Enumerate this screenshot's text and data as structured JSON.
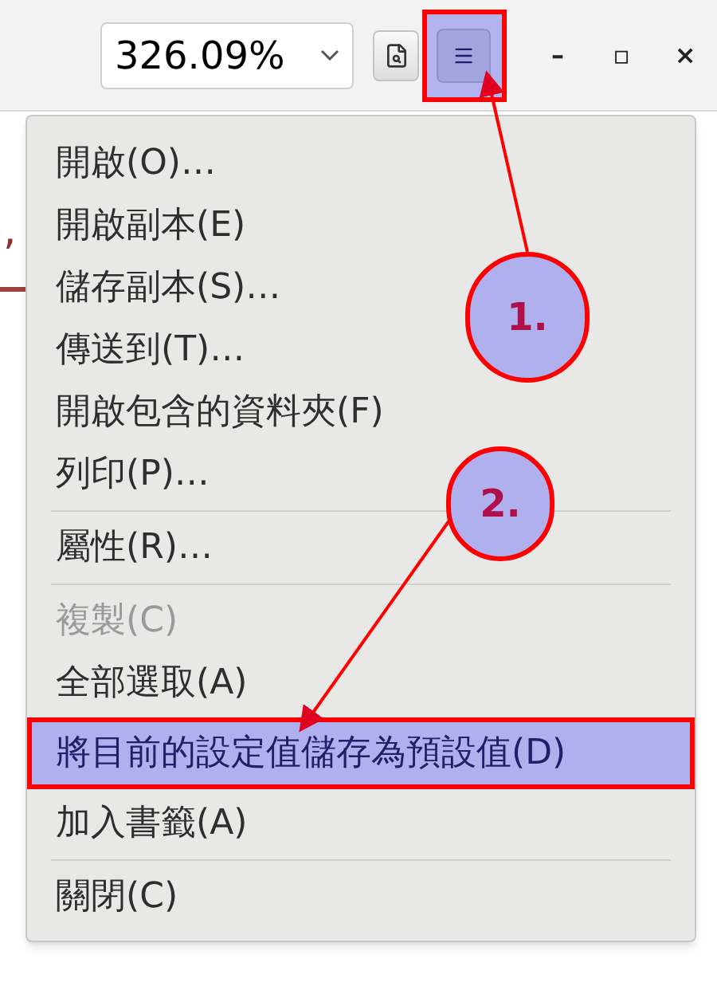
{
  "toolbar": {
    "zoom_value": "326.09%",
    "menu_button": {
      "selected": true
    },
    "window_controls": [
      "–",
      "▫",
      "×"
    ]
  },
  "document": {
    "text": ","
  },
  "menu": [
    {
      "kind": "item",
      "label": "開啟(O)…",
      "disabled": false,
      "selected": false
    },
    {
      "kind": "item",
      "label": "開啟副本(E)",
      "disabled": false,
      "selected": false
    },
    {
      "kind": "item",
      "label": "儲存副本(S)…",
      "disabled": false,
      "selected": false
    },
    {
      "kind": "item",
      "label": "傳送到(T)…",
      "disabled": false,
      "selected": false
    },
    {
      "kind": "item",
      "label": "開啟包含的資料夾(F)",
      "disabled": false,
      "selected": false
    },
    {
      "kind": "item",
      "label": "列印(P)…",
      "disabled": false,
      "selected": false
    },
    {
      "kind": "separator"
    },
    {
      "kind": "item",
      "label": "屬性(R)…",
      "disabled": false,
      "selected": false
    },
    {
      "kind": "separator"
    },
    {
      "kind": "item",
      "label": "複製(C)",
      "disabled": true,
      "selected": false
    },
    {
      "kind": "item",
      "label": "全部選取(A)",
      "disabled": false,
      "selected": false
    },
    {
      "kind": "item",
      "label": "將目前的設定值儲存為預設值(D)",
      "disabled": false,
      "selected": true
    },
    {
      "kind": "item",
      "label": "加入書籤(A)",
      "disabled": false,
      "selected": false
    },
    {
      "kind": "separator"
    },
    {
      "kind": "item",
      "label": "關閉(C)",
      "disabled": false,
      "selected": false
    }
  ],
  "annotations": [
    {
      "label": "1."
    },
    {
      "label": "2."
    }
  ]
}
